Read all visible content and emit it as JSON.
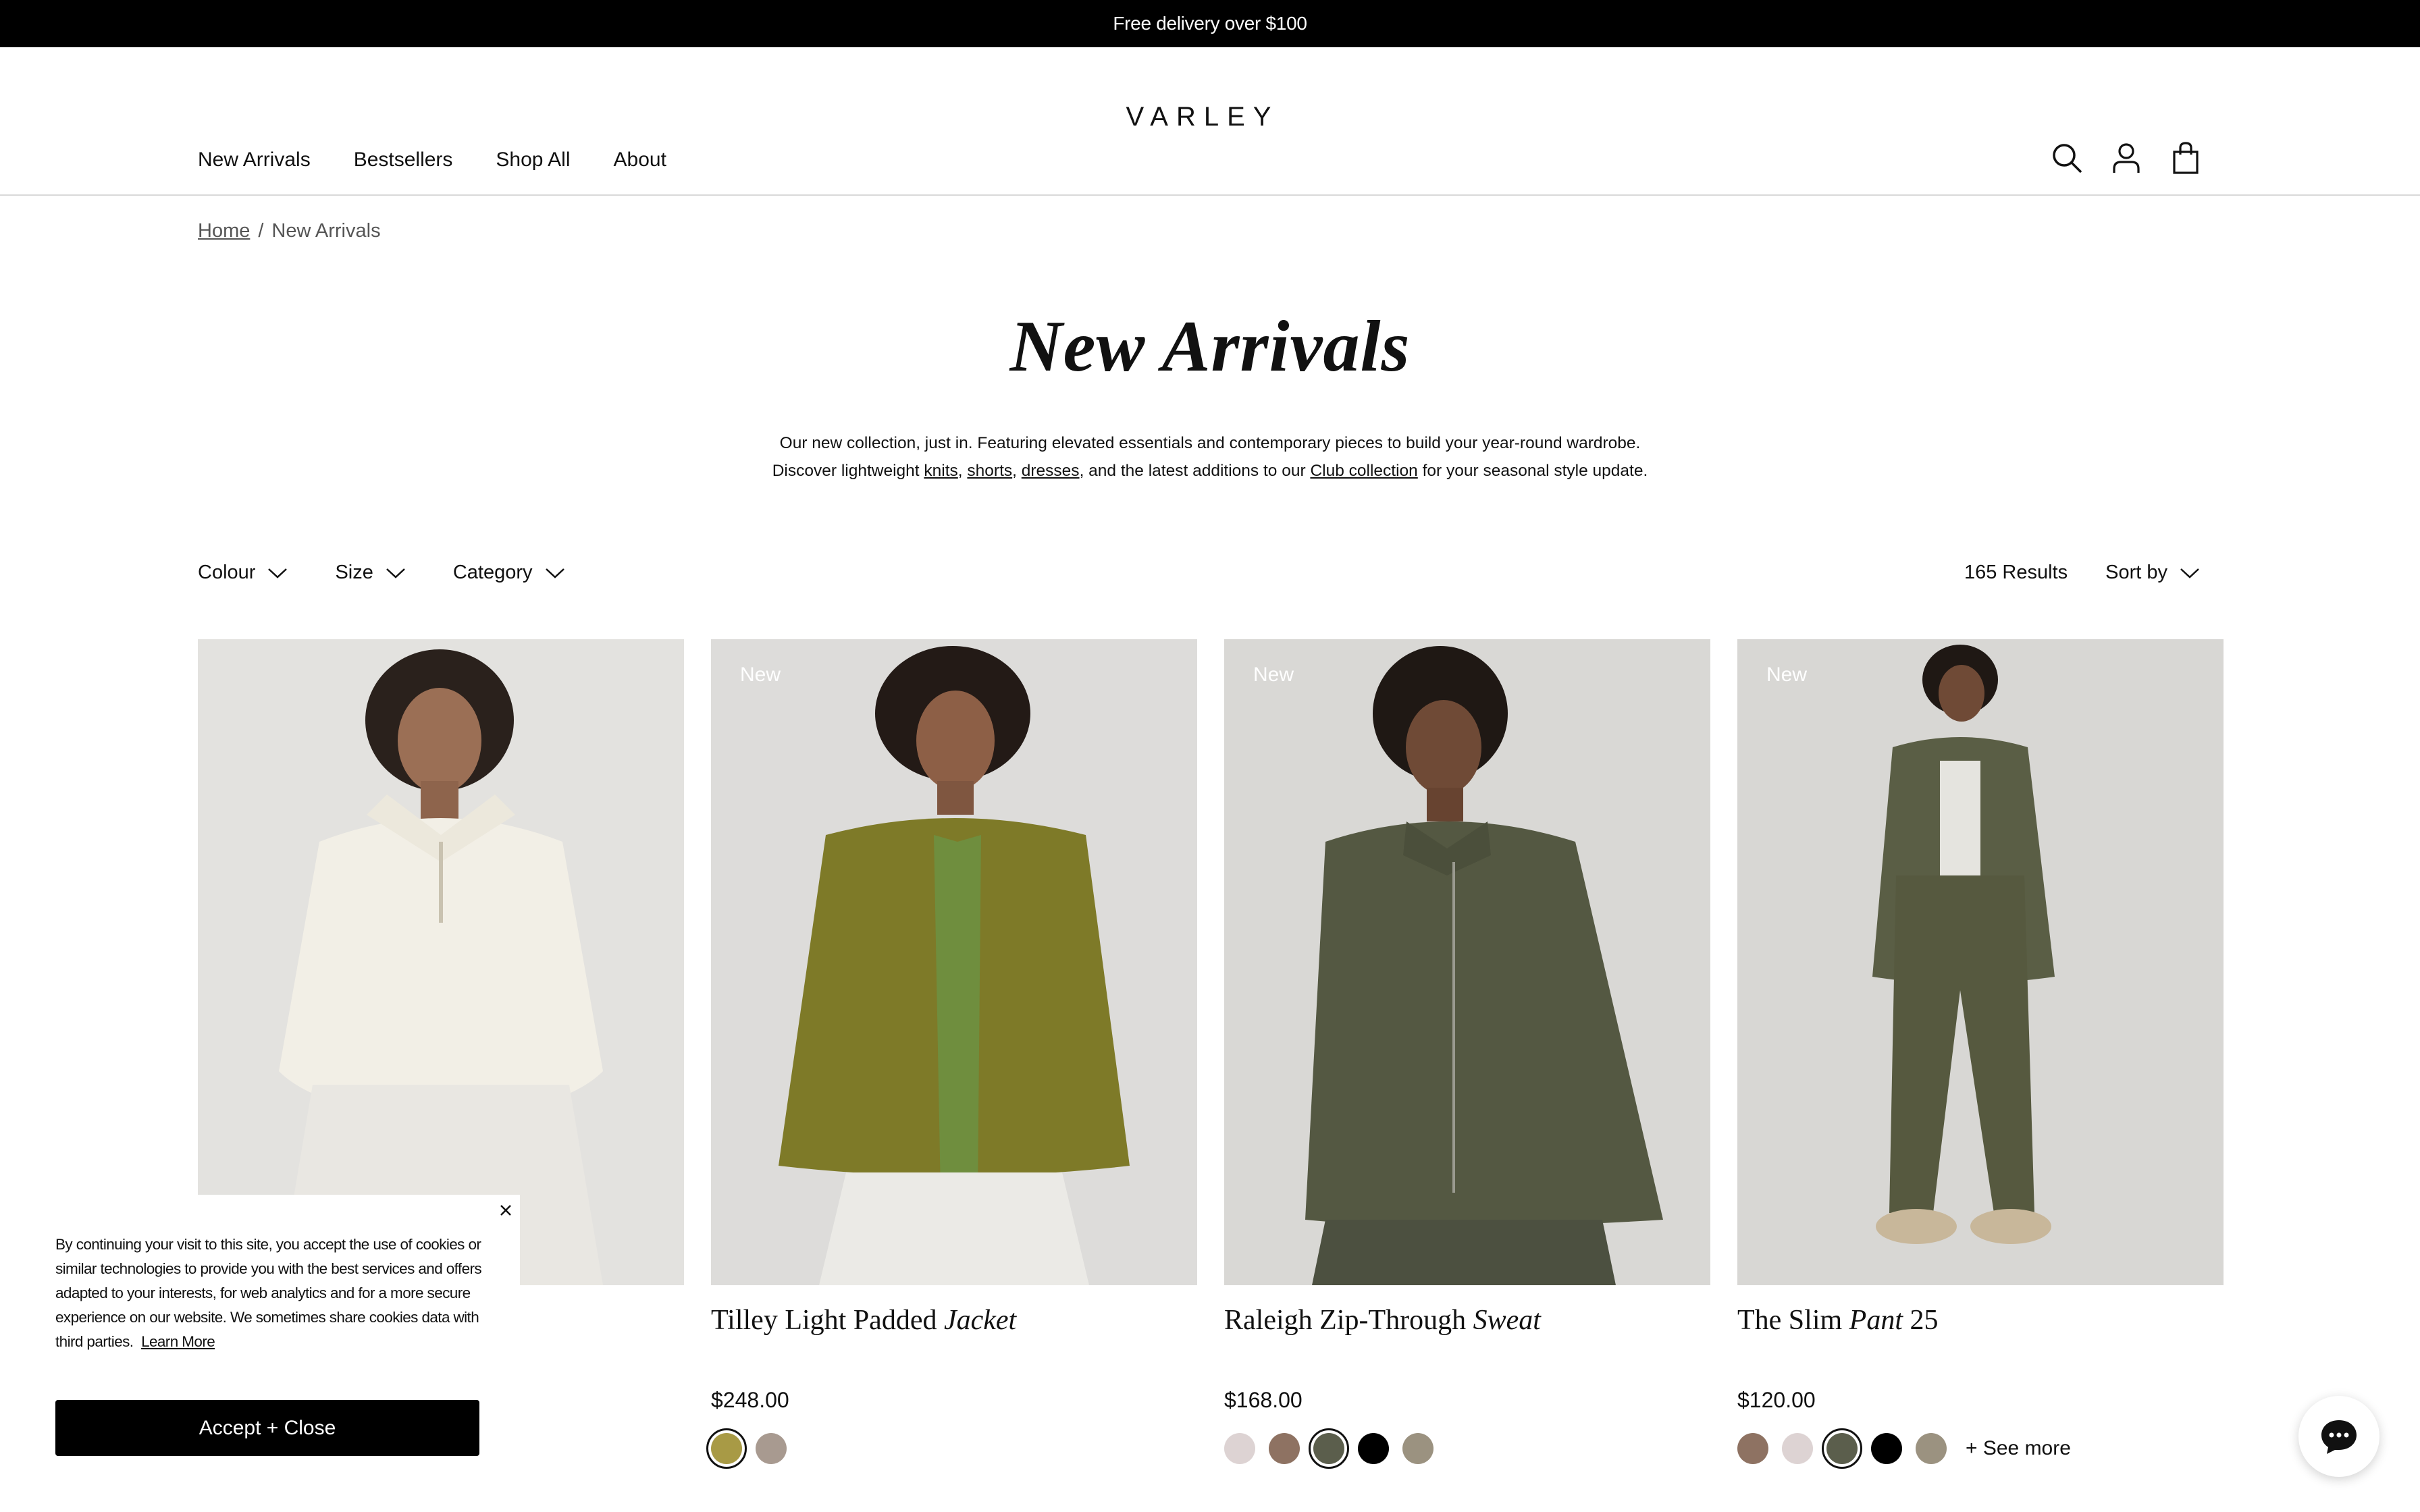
{
  "promo": {
    "text": "Free delivery over $100"
  },
  "header": {
    "logo": "VARLEY",
    "nav": [
      "New Arrivals",
      "Bestsellers",
      "Shop All",
      "About"
    ],
    "icons": [
      "search-icon",
      "account-icon",
      "bag-icon"
    ]
  },
  "breadcrumb": {
    "home": "Home",
    "separator": "/",
    "current": "New Arrivals"
  },
  "page": {
    "title": "New Arrivals",
    "intro_line1": "Our new collection, just in. Featuring elevated essentials and contemporary pieces to build your year-round wardrobe.",
    "intro_line2_pre": "Discover lightweight",
    "link_knits": "knits",
    "link_shorts": "shorts",
    "link_dresses": "dresses",
    "intro_line2_mid": ", and the latest additions to our",
    "link_club": "Club collection",
    "intro_line2_post": "for your seasonal style update."
  },
  "filters": {
    "colour": "Colour",
    "size": "Size",
    "category": "Category",
    "results": "165 Results",
    "sort": "Sort by"
  },
  "products": [
    {
      "badge": "",
      "name_plain": "",
      "name_italic": "",
      "name_suffix": "",
      "price": "",
      "swatches": []
    },
    {
      "badge": "New",
      "name_plain": "Tilley Light Padded",
      "name_italic": "Jacket",
      "name_suffix": "",
      "price": "$248.00",
      "swatches": [
        "#a89a45",
        "#a89a90"
      ],
      "selected_swatch": 0
    },
    {
      "badge": "New",
      "name_plain": "Raleigh Zip-Through",
      "name_italic": "Sweat",
      "name_suffix": "",
      "price": "$168.00",
      "swatches": [
        "#ddd3d3",
        "#8e7262",
        "#5b5e4c",
        "#000000",
        "#9b9280"
      ],
      "selected_swatch": 2
    },
    {
      "badge": "New",
      "name_plain": "The Slim",
      "name_italic": "Pant",
      "name_suffix": "25",
      "price": "$120.00",
      "swatches": [
        "#8e7262",
        "#ddd3d3",
        "#5b5e4c",
        "#000000",
        "#9b9280"
      ],
      "selected_swatch": 2,
      "see_more": "+ See more"
    }
  ],
  "cookie": {
    "text": "By continuing your visit to this site, you accept the use of cookies or similar technologies to provide you with the best services and offers adapted to your interests, for web analytics and for a more secure experience on our website. We sometimes share cookies data with third parties.",
    "learn_more": "Learn More",
    "accept": "Accept + Close"
  },
  "colors": {
    "accent": "#000000",
    "background": "#ffffff",
    "photo_bg": "#e2e1df"
  }
}
